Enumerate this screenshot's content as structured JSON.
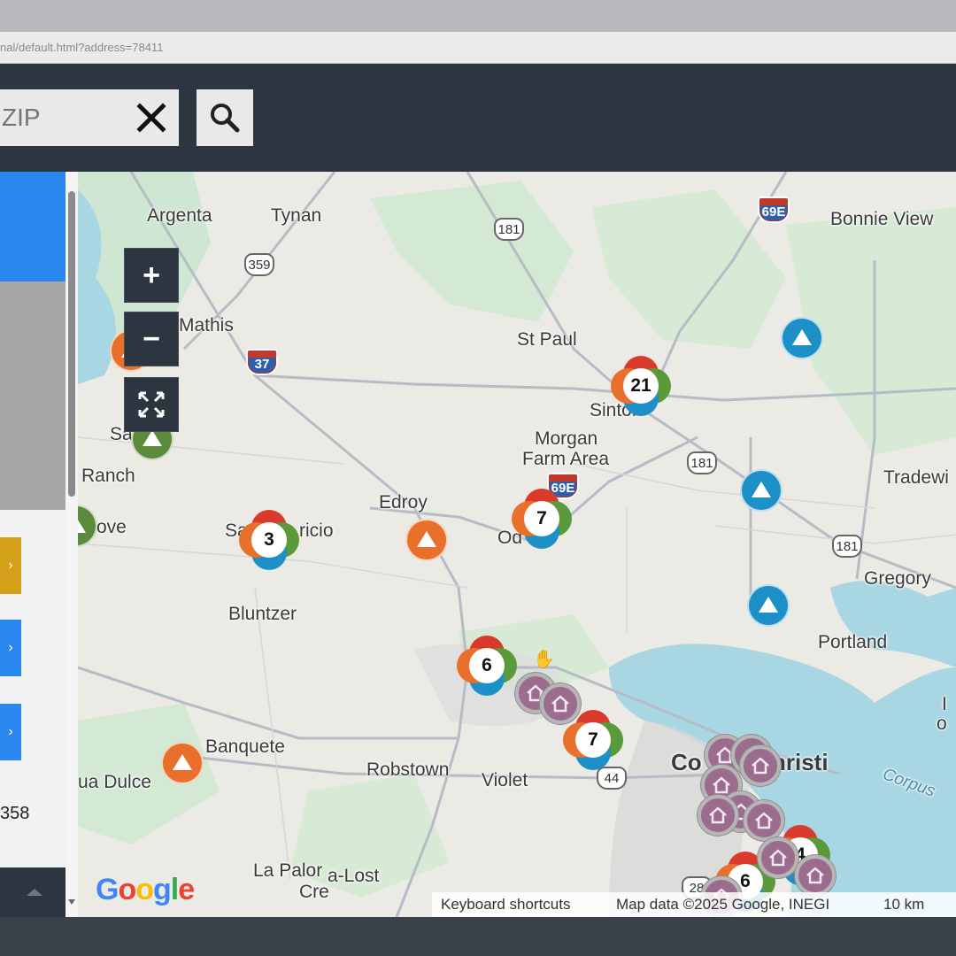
{
  "browser": {
    "url": "nal/default.html?address=78411"
  },
  "search": {
    "placeholder": "ZIP",
    "clear_icon": "close-icon",
    "search_icon": "search-icon"
  },
  "sidebar": {
    "button_icon": "chevron-right-icon",
    "button_colors": [
      "#d4a017",
      "#2b87f0",
      "#2b87f0"
    ],
    "number": "358"
  },
  "map": {
    "controls": {
      "zoom_in": "+",
      "zoom_out": "−",
      "fullscreen_icon": "fullscreen-icon"
    },
    "places": [
      {
        "name": "Argenta"
      },
      {
        "name": "Tynan"
      },
      {
        "name": "Bonnie View"
      },
      {
        "name": "Mathis"
      },
      {
        "name": "St Paul"
      },
      {
        "name": "Sinton"
      },
      {
        "name": "Morgan"
      },
      {
        "name": "Farm Area"
      },
      {
        "name": "Sa"
      },
      {
        "name": "Ranch"
      },
      {
        "name": "Tradewi"
      },
      {
        "name": "Edroy"
      },
      {
        "name": "rove"
      },
      {
        "name": "Sa"
      },
      {
        "name": "ricio"
      },
      {
        "name": "Od"
      },
      {
        "name": "Gregory"
      },
      {
        "name": "Bluntzer"
      },
      {
        "name": "Portland"
      },
      {
        "name": "Banquete"
      },
      {
        "name": "Robstown"
      },
      {
        "name": "Violet"
      },
      {
        "name": "Co"
      },
      {
        "name": "hristi"
      },
      {
        "name": "ua Dulce"
      },
      {
        "name": "La Palor"
      },
      {
        "name": "a-Lost"
      },
      {
        "name": "Cre"
      },
      {
        "name": "Corpus"
      },
      {
        "name": "I"
      },
      {
        "name": "o"
      }
    ],
    "routes": [
      {
        "label": "181"
      },
      {
        "label": "359"
      },
      {
        "label": "181"
      },
      {
        "label": "181"
      },
      {
        "label": "44"
      },
      {
        "label": "28"
      }
    ],
    "interstates": [
      {
        "label": "69E"
      },
      {
        "label": "37"
      },
      {
        "label": "69E"
      }
    ],
    "clusters": [
      {
        "count": "21"
      },
      {
        "count": "7"
      },
      {
        "count": "3"
      },
      {
        "count": "6"
      },
      {
        "count": "7"
      },
      {
        "count": "4"
      },
      {
        "count": "6"
      }
    ],
    "markers": [
      {
        "type": "triangle",
        "color": "#1e90c8"
      },
      {
        "type": "triangle",
        "color": "#1e90c8"
      },
      {
        "type": "triangle",
        "color": "#1e90c8"
      },
      {
        "type": "triangle",
        "color": "#e8702a"
      },
      {
        "type": "triangle",
        "color": "#e8702a"
      },
      {
        "type": "triangle",
        "color": "#5a8a3a"
      }
    ],
    "house_marker_color": "#9b6c8e",
    "attribution": {
      "keyboard": "Keyboard shortcuts",
      "data": "Map data ©2025 Google, INEGI",
      "scale": "10 km"
    },
    "logo": "Google"
  }
}
